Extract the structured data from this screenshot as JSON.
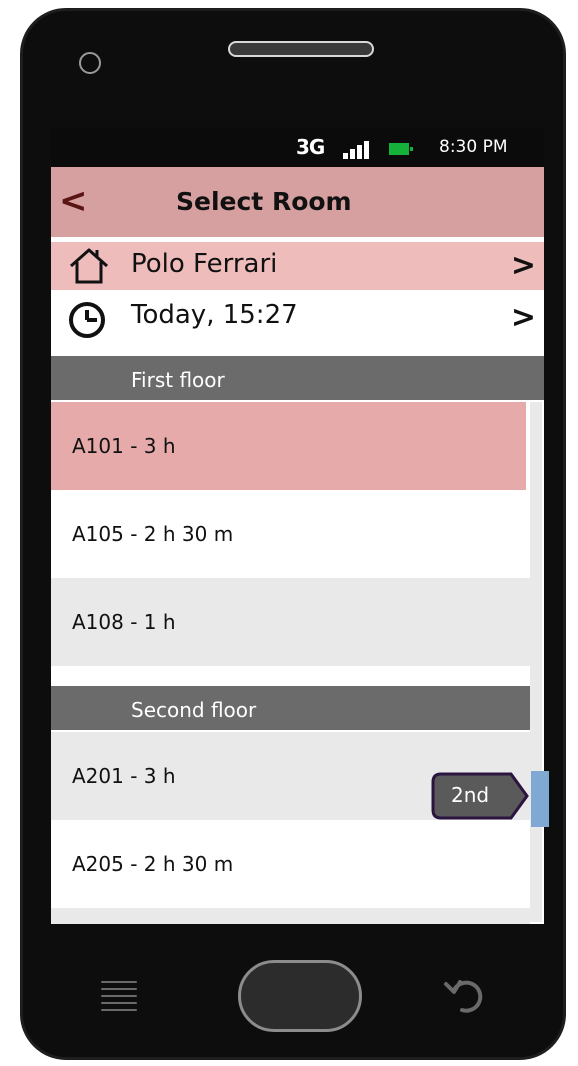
{
  "status_bar": {
    "network": "3G",
    "signal_icon": "signal-bars-icon",
    "battery_icon": "battery-icon",
    "time": "8:30 PM"
  },
  "header": {
    "back_icon": "chevron-left-icon",
    "title": "Select Room"
  },
  "location": {
    "icon": "house-icon",
    "label": "Polo Ferrari",
    "chevron_icon": "chevron-right-icon"
  },
  "datetime": {
    "icon": "clock-icon",
    "label": "Today, 15:27",
    "chevron_icon": "chevron-right-icon"
  },
  "sections": [
    {
      "title": "First floor",
      "rooms": [
        {
          "label": "A101 - 3 h",
          "selected": true
        },
        {
          "label": "A105 - 2 h 30 m",
          "selected": false
        },
        {
          "label": "A108 - 1 h",
          "selected": false
        }
      ]
    },
    {
      "title": "Second floor",
      "rooms": [
        {
          "label": "A201 - 3 h",
          "selected": false
        },
        {
          "label": "A205 - 2 h 30 m",
          "selected": false
        }
      ]
    }
  ],
  "scroll_indicator": {
    "label": "2nd"
  },
  "colors": {
    "header_bg": "#d7a0a0",
    "selected_bg": "#e6aaaa",
    "section_bg": "#6b6b6b",
    "scroll_thumb": "#7fa8d2"
  },
  "softkeys": {
    "menu_icon": "menu-icon",
    "home_icon": "home-button-icon",
    "back_icon": "back-arrow-icon"
  }
}
